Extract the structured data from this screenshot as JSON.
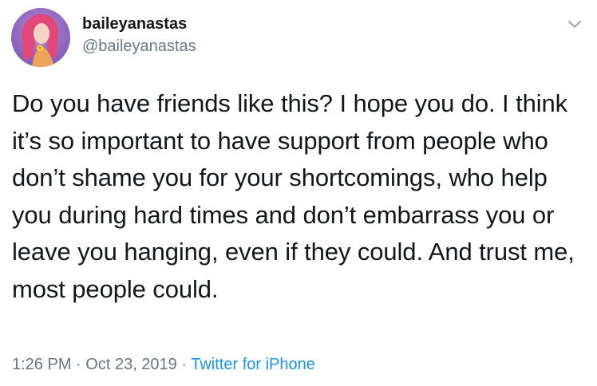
{
  "user": {
    "display_name": "baileyanastas",
    "handle": "@baileyanastas",
    "avatar_icon": "profile-avatar"
  },
  "tweet": {
    "text": "Do you have friends like this? I hope you do. I think it’s so important to have support from people who don’t shame you for your shortcomings, who help you during hard times and don’t embarrass you or leave you hanging, even if they could. And trust me, most people could.",
    "time": "1:26 PM",
    "date": "Oct 23, 2019",
    "separator": "·",
    "source": "Twitter for iPhone"
  },
  "menu": {
    "icon": "chevron-down-icon"
  },
  "colors": {
    "text": "#14171a",
    "secondary": "#657786",
    "link": "#1b95e0"
  }
}
